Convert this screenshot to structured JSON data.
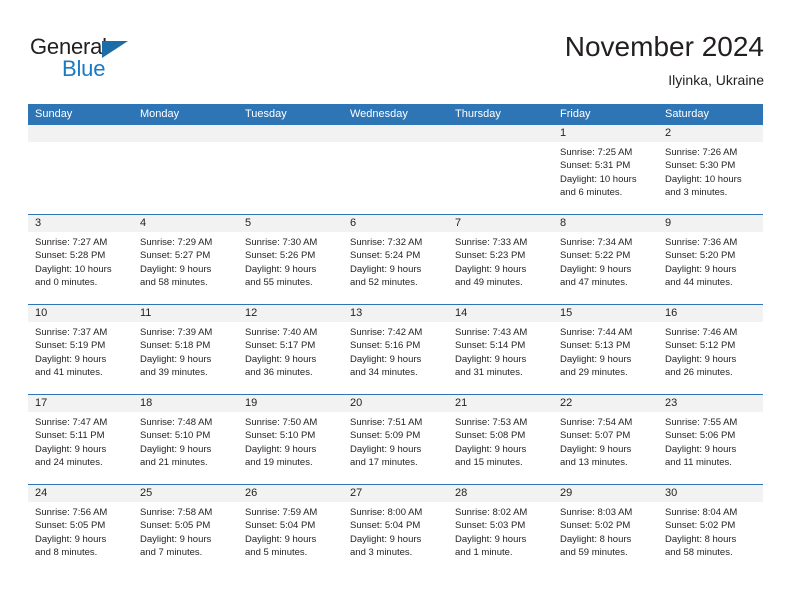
{
  "brand": {
    "name_top": "General",
    "name_bottom": "Blue",
    "triangle_color": "#1b6ca8",
    "blue_color": "#1b7ac4"
  },
  "header": {
    "month_title": "November 2024",
    "location": "Ilyinka, Ukraine"
  },
  "colors": {
    "header_blue": "#2e75b6",
    "day_band_gray": "#f2f2f2",
    "text": "#231f20",
    "weekday_text": "#ffffff"
  },
  "weekdays": [
    "Sunday",
    "Monday",
    "Tuesday",
    "Wednesday",
    "Thursday",
    "Friday",
    "Saturday"
  ],
  "weeks": [
    [
      {
        "day": ""
      },
      {
        "day": ""
      },
      {
        "day": ""
      },
      {
        "day": ""
      },
      {
        "day": ""
      },
      {
        "day": "1",
        "sunrise": "Sunrise: 7:25 AM",
        "sunset": "Sunset: 5:31 PM",
        "daylight1": "Daylight: 10 hours",
        "daylight2": "and 6 minutes."
      },
      {
        "day": "2",
        "sunrise": "Sunrise: 7:26 AM",
        "sunset": "Sunset: 5:30 PM",
        "daylight1": "Daylight: 10 hours",
        "daylight2": "and 3 minutes."
      }
    ],
    [
      {
        "day": "3",
        "sunrise": "Sunrise: 7:27 AM",
        "sunset": "Sunset: 5:28 PM",
        "daylight1": "Daylight: 10 hours",
        "daylight2": "and 0 minutes."
      },
      {
        "day": "4",
        "sunrise": "Sunrise: 7:29 AM",
        "sunset": "Sunset: 5:27 PM",
        "daylight1": "Daylight: 9 hours",
        "daylight2": "and 58 minutes."
      },
      {
        "day": "5",
        "sunrise": "Sunrise: 7:30 AM",
        "sunset": "Sunset: 5:26 PM",
        "daylight1": "Daylight: 9 hours",
        "daylight2": "and 55 minutes."
      },
      {
        "day": "6",
        "sunrise": "Sunrise: 7:32 AM",
        "sunset": "Sunset: 5:24 PM",
        "daylight1": "Daylight: 9 hours",
        "daylight2": "and 52 minutes."
      },
      {
        "day": "7",
        "sunrise": "Sunrise: 7:33 AM",
        "sunset": "Sunset: 5:23 PM",
        "daylight1": "Daylight: 9 hours",
        "daylight2": "and 49 minutes."
      },
      {
        "day": "8",
        "sunrise": "Sunrise: 7:34 AM",
        "sunset": "Sunset: 5:22 PM",
        "daylight1": "Daylight: 9 hours",
        "daylight2": "and 47 minutes."
      },
      {
        "day": "9",
        "sunrise": "Sunrise: 7:36 AM",
        "sunset": "Sunset: 5:20 PM",
        "daylight1": "Daylight: 9 hours",
        "daylight2": "and 44 minutes."
      }
    ],
    [
      {
        "day": "10",
        "sunrise": "Sunrise: 7:37 AM",
        "sunset": "Sunset: 5:19 PM",
        "daylight1": "Daylight: 9 hours",
        "daylight2": "and 41 minutes."
      },
      {
        "day": "11",
        "sunrise": "Sunrise: 7:39 AM",
        "sunset": "Sunset: 5:18 PM",
        "daylight1": "Daylight: 9 hours",
        "daylight2": "and 39 minutes."
      },
      {
        "day": "12",
        "sunrise": "Sunrise: 7:40 AM",
        "sunset": "Sunset: 5:17 PM",
        "daylight1": "Daylight: 9 hours",
        "daylight2": "and 36 minutes."
      },
      {
        "day": "13",
        "sunrise": "Sunrise: 7:42 AM",
        "sunset": "Sunset: 5:16 PM",
        "daylight1": "Daylight: 9 hours",
        "daylight2": "and 34 minutes."
      },
      {
        "day": "14",
        "sunrise": "Sunrise: 7:43 AM",
        "sunset": "Sunset: 5:14 PM",
        "daylight1": "Daylight: 9 hours",
        "daylight2": "and 31 minutes."
      },
      {
        "day": "15",
        "sunrise": "Sunrise: 7:44 AM",
        "sunset": "Sunset: 5:13 PM",
        "daylight1": "Daylight: 9 hours",
        "daylight2": "and 29 minutes."
      },
      {
        "day": "16",
        "sunrise": "Sunrise: 7:46 AM",
        "sunset": "Sunset: 5:12 PM",
        "daylight1": "Daylight: 9 hours",
        "daylight2": "and 26 minutes."
      }
    ],
    [
      {
        "day": "17",
        "sunrise": "Sunrise: 7:47 AM",
        "sunset": "Sunset: 5:11 PM",
        "daylight1": "Daylight: 9 hours",
        "daylight2": "and 24 minutes."
      },
      {
        "day": "18",
        "sunrise": "Sunrise: 7:48 AM",
        "sunset": "Sunset: 5:10 PM",
        "daylight1": "Daylight: 9 hours",
        "daylight2": "and 21 minutes."
      },
      {
        "day": "19",
        "sunrise": "Sunrise: 7:50 AM",
        "sunset": "Sunset: 5:10 PM",
        "daylight1": "Daylight: 9 hours",
        "daylight2": "and 19 minutes."
      },
      {
        "day": "20",
        "sunrise": "Sunrise: 7:51 AM",
        "sunset": "Sunset: 5:09 PM",
        "daylight1": "Daylight: 9 hours",
        "daylight2": "and 17 minutes."
      },
      {
        "day": "21",
        "sunrise": "Sunrise: 7:53 AM",
        "sunset": "Sunset: 5:08 PM",
        "daylight1": "Daylight: 9 hours",
        "daylight2": "and 15 minutes."
      },
      {
        "day": "22",
        "sunrise": "Sunrise: 7:54 AM",
        "sunset": "Sunset: 5:07 PM",
        "daylight1": "Daylight: 9 hours",
        "daylight2": "and 13 minutes."
      },
      {
        "day": "23",
        "sunrise": "Sunrise: 7:55 AM",
        "sunset": "Sunset: 5:06 PM",
        "daylight1": "Daylight: 9 hours",
        "daylight2": "and 11 minutes."
      }
    ],
    [
      {
        "day": "24",
        "sunrise": "Sunrise: 7:56 AM",
        "sunset": "Sunset: 5:05 PM",
        "daylight1": "Daylight: 9 hours",
        "daylight2": "and 8 minutes."
      },
      {
        "day": "25",
        "sunrise": "Sunrise: 7:58 AM",
        "sunset": "Sunset: 5:05 PM",
        "daylight1": "Daylight: 9 hours",
        "daylight2": "and 7 minutes."
      },
      {
        "day": "26",
        "sunrise": "Sunrise: 7:59 AM",
        "sunset": "Sunset: 5:04 PM",
        "daylight1": "Daylight: 9 hours",
        "daylight2": "and 5 minutes."
      },
      {
        "day": "27",
        "sunrise": "Sunrise: 8:00 AM",
        "sunset": "Sunset: 5:04 PM",
        "daylight1": "Daylight: 9 hours",
        "daylight2": "and 3 minutes."
      },
      {
        "day": "28",
        "sunrise": "Sunrise: 8:02 AM",
        "sunset": "Sunset: 5:03 PM",
        "daylight1": "Daylight: 9 hours",
        "daylight2": "and 1 minute."
      },
      {
        "day": "29",
        "sunrise": "Sunrise: 8:03 AM",
        "sunset": "Sunset: 5:02 PM",
        "daylight1": "Daylight: 8 hours",
        "daylight2": "and 59 minutes."
      },
      {
        "day": "30",
        "sunrise": "Sunrise: 8:04 AM",
        "sunset": "Sunset: 5:02 PM",
        "daylight1": "Daylight: 8 hours",
        "daylight2": "and 58 minutes."
      }
    ]
  ]
}
